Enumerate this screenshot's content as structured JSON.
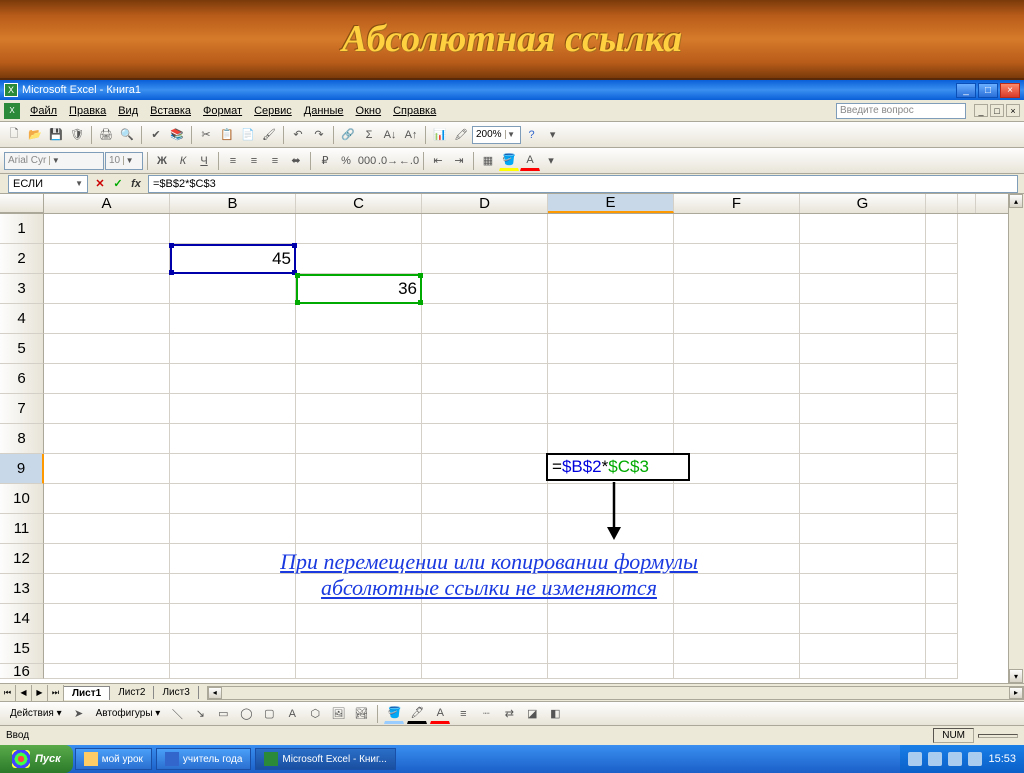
{
  "slide_title": "Абсолютная ссылка",
  "app_title": "Microsoft Excel - Книга1",
  "menu": {
    "file": "Файл",
    "edit": "Правка",
    "view": "Вид",
    "insert": "Вставка",
    "format": "Формат",
    "tools": "Сервис",
    "data": "Данные",
    "window": "Окно",
    "help": "Справка"
  },
  "question_placeholder": "Введите вопрос",
  "font_name": "Arial Cyr",
  "font_size": "10",
  "zoom": "200%",
  "name_box": "ЕСЛИ",
  "formula": "=$B$2*$C$3",
  "columns": [
    "A",
    "B",
    "C",
    "D",
    "E",
    "F",
    "G"
  ],
  "active_col": "E",
  "rows": [
    "1",
    "2",
    "3",
    "4",
    "5",
    "6",
    "7",
    "8",
    "9",
    "10",
    "11",
    "12",
    "13",
    "14",
    "15",
    "16"
  ],
  "active_row": "9",
  "cell_b2": "45",
  "cell_c3": "36",
  "edit_eq": "=",
  "edit_ref1": "$B$2",
  "edit_star": "*",
  "edit_ref2": "$C$3",
  "annotation_line1": "При перемещении или копировании формулы",
  "annotation_line2": "абсолютные ссылки не изменяются",
  "sheets": {
    "s1": "Лист1",
    "s2": "Лист2",
    "s3": "Лист3"
  },
  "draw_actions": "Действия",
  "draw_autoshapes": "Автофигуры",
  "status_mode": "Ввод",
  "status_num": "NUM",
  "start_label": "Пуск",
  "task_folder": "мой урок",
  "task_word": "учитель года",
  "task_excel": "Microsoft Excel - Книг...",
  "clock": "15:53"
}
